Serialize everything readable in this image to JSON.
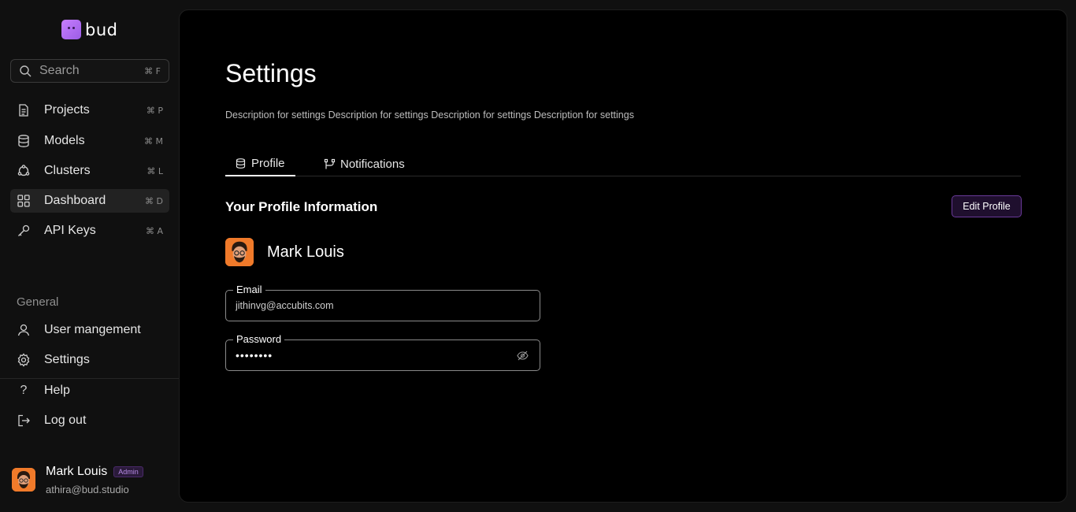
{
  "app": {
    "logo_text": "bud"
  },
  "sidebar": {
    "search": {
      "placeholder": "Search",
      "shortcut": "⌘ F"
    },
    "items": [
      {
        "label": "Projects",
        "shortcut": "⌘ P",
        "icon": "document-icon"
      },
      {
        "label": "Models",
        "shortcut": "⌘ M",
        "icon": "database-icon"
      },
      {
        "label": "Clusters",
        "shortcut": "⌘ L",
        "icon": "cluster-icon"
      },
      {
        "label": "Dashboard",
        "shortcut": "⌘ D",
        "icon": "grid-icon",
        "active": true
      },
      {
        "label": "API Keys",
        "shortcut": "⌘ A",
        "icon": "key-icon"
      }
    ],
    "general_title": "General",
    "general_items": [
      {
        "label": "User mangement",
        "icon": "user-icon"
      },
      {
        "label": "Settings",
        "icon": "gear-icon"
      },
      {
        "label": "Help",
        "icon": "question-icon"
      },
      {
        "label": "Log out",
        "icon": "logout-icon"
      }
    ],
    "user": {
      "name": "Mark Louis",
      "role": "Admin",
      "email": "athira@bud.studio"
    }
  },
  "main": {
    "title": "Settings",
    "description": "Description for settings Description for settings Description for settings Description for settings",
    "tabs": [
      {
        "label": "Profile",
        "active": true,
        "icon": "database-icon"
      },
      {
        "label": "Notifications",
        "active": false,
        "icon": "branch-icon"
      }
    ],
    "section_title": "Your Profile Information",
    "edit_button": "Edit Profile",
    "profile_name": "Mark Louis",
    "fields": {
      "email": {
        "label": "Email",
        "value": "jithinvg@accubits.com"
      },
      "password": {
        "label": "Password",
        "value": "••••••••"
      }
    }
  },
  "colors": {
    "accent": "#6a3a9a",
    "background": "#000000",
    "sidebar_bg": "#101010"
  }
}
